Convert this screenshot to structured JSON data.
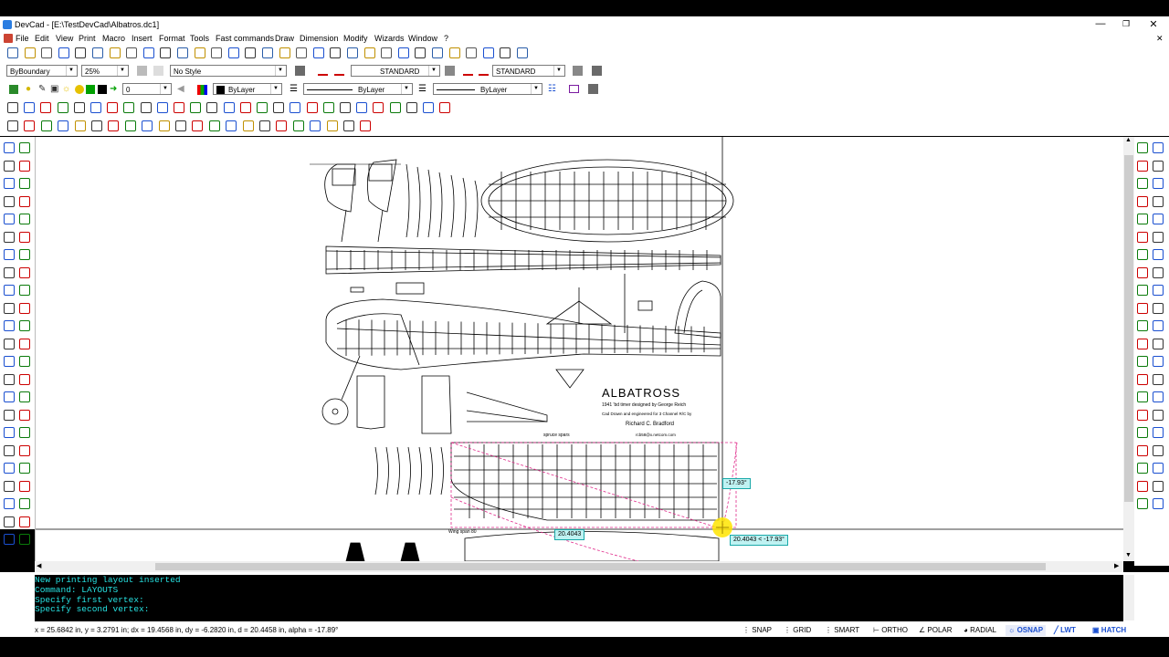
{
  "window": {
    "title": "DevCad - [E:\\TestDevCad\\Albatros.dc1]",
    "min_icon": "minimize-icon",
    "restore_icon": "restore-icon",
    "close_icon": "close-icon"
  },
  "menu": [
    "File",
    "Edit",
    "View",
    "Print",
    "Macro",
    "Insert",
    "Format",
    "Tools",
    "Fast commands",
    "Draw",
    "Dimension",
    "Modify",
    "Wizards",
    "Window",
    "?"
  ],
  "toolbar": {
    "boundary": "ByBoundary",
    "zoom": "25%",
    "style": "No Style",
    "text_style": "STANDARD",
    "dim_style": "STANDARD",
    "layer": "0",
    "color": "ByLayer",
    "linetype": "ByLayer",
    "lineweight": "ByLayer"
  },
  "drawing": {
    "title": "ALBATROSS",
    "line1": "1941 'bd timer designed by George Reich",
    "line2": "Cad Drawn and engineered for 3 Channel R/C by",
    "author": "Richard C. Bradford",
    "email": "rcb58@x.netcom.com",
    "spruce": "spruce spars",
    "wingspan": "Wing span 80",
    "tooltip_angle": "-17.93°",
    "tooltip_dist": "20.4043",
    "tooltip_full": "20.4043 < -17.93°"
  },
  "command": {
    "lines": [
      "New printing layout inserted",
      "Command: LAYOUTS",
      "Specify first vertex:",
      "Specify second vertex:"
    ]
  },
  "status": {
    "coords": "x = 25.6842 in, y = 3.2791 in; dx = 19.4568 in, dy = -6.2820 in, d = 20.4458 in, alpha = -17.89°",
    "buttons": [
      {
        "label": "SNAP",
        "on": false
      },
      {
        "label": "GRID",
        "on": false
      },
      {
        "label": "SMART",
        "on": false
      },
      {
        "label": "ORTHO",
        "on": false
      },
      {
        "label": "POLAR",
        "on": false
      },
      {
        "label": "RADIAL",
        "on": false
      },
      {
        "label": "OSNAP",
        "on": true
      },
      {
        "label": "LWT",
        "on": true
      },
      {
        "label": "HATCH",
        "on": true
      }
    ]
  },
  "colors": {
    "accent": "#1a4fd0",
    "cmd_text": "#27e3e3",
    "marker": "#ffe500",
    "dashed": "#e02a8a",
    "tooltip_bg": "#bff2f2"
  }
}
